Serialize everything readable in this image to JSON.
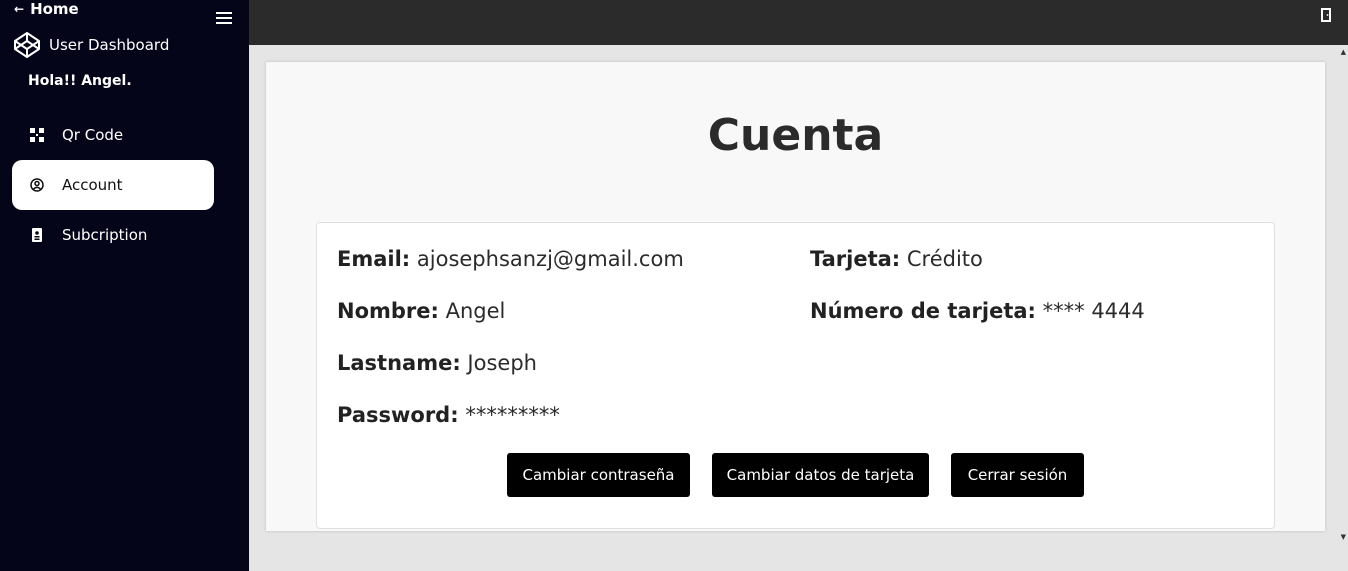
{
  "sidebar": {
    "home_label": "Home",
    "brand_label": "User Dashboard",
    "greeting": "Hola!! Angel.",
    "items": [
      {
        "label": "Qr Code",
        "icon": "qr-code-icon",
        "active": false
      },
      {
        "label": "Account",
        "icon": "user-circle-icon",
        "active": true
      },
      {
        "label": "Subcription",
        "icon": "subscription-card-icon",
        "active": false
      }
    ]
  },
  "main": {
    "title": "Cuenta",
    "fields": {
      "email_label": "Email:",
      "email_value": "ajosephsanzj@gmail.com",
      "nombre_label": "Nombre:",
      "nombre_value": "Angel",
      "lastname_label": "Lastname:",
      "lastname_value": "Joseph",
      "password_label": "Password:",
      "password_value": "*********",
      "tarjeta_label": "Tarjeta:",
      "tarjeta_value": "Crédito",
      "numero_label": "Número de tarjeta:",
      "numero_value": "**** 4444"
    },
    "buttons": {
      "change_password": "Cambiar contraseña",
      "change_card": "Cambiar datos de tarjeta",
      "logout": "Cerrar sesión"
    }
  },
  "colors": {
    "sidebar_bg": "#05051a",
    "topbar_bg": "#2b2b2b",
    "button_bg": "#000000",
    "page_bg": "#e5e5e5"
  }
}
